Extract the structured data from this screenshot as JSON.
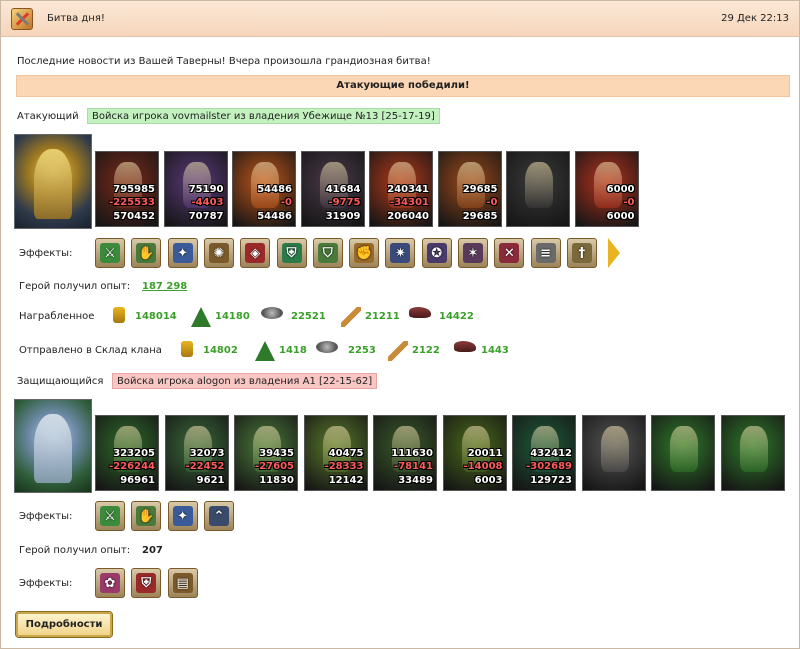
{
  "window": {
    "title": "Битва дня!",
    "date": "29 Дек 22:13"
  },
  "news": "Последние новости из Вашей Таверны! Вчера произошла грандиозная битва!",
  "banner": "Атакующие победили!",
  "attacker": {
    "label": "Атакующий",
    "tag": "Войска игрока vovmailster из владения Убежище №13 [25-17-19]",
    "units": [
      {
        "a": "795985",
        "b": "-225533",
        "c": "570452",
        "color": "#7a2a1a"
      },
      {
        "a": "75190",
        "b": "-4403",
        "c": "70787",
        "color": "#5a3a7a"
      },
      {
        "a": "54486",
        "b": "-0",
        "c": "54486",
        "color": "#c0561a"
      },
      {
        "a": "41684",
        "b": "-9775",
        "c": "31909",
        "color": "#4a3a4a"
      },
      {
        "a": "240341",
        "b": "-34301",
        "c": "206040",
        "color": "#b33a1a"
      },
      {
        "a": "29685",
        "b": "-0",
        "c": "29685",
        "color": "#9c4a1a"
      },
      {
        "a": "",
        "b": "",
        "c": "",
        "color": "#3a3a3a"
      },
      {
        "a": "6000",
        "b": "-0",
        "c": "6000",
        "color": "#b3321e"
      }
    ],
    "effects_label": "Эффекты:",
    "effects": [
      {
        "icon": "sword-icon",
        "glyph": "⚔",
        "color": "#3c8a3c"
      },
      {
        "icon": "handshake-icon",
        "glyph": "✋",
        "color": "#4a7a3a"
      },
      {
        "icon": "magic-hand-icon",
        "glyph": "✦",
        "color": "#3a5a9a"
      },
      {
        "icon": "wolf-icon",
        "glyph": "✺",
        "color": "#7a5a2a"
      },
      {
        "icon": "dice-icon",
        "glyph": "◈",
        "color": "#9a2a2a"
      },
      {
        "icon": "shield-icon",
        "glyph": "⛨",
        "color": "#2a7a4a"
      },
      {
        "icon": "shield-hand-icon",
        "glyph": "⛉",
        "color": "#4a7a3a"
      },
      {
        "icon": "fist-icon",
        "glyph": "✊",
        "color": "#9a6a2a"
      },
      {
        "icon": "dragon-icon",
        "glyph": "✷",
        "color": "#3a4a7a"
      },
      {
        "icon": "pentagram-icon",
        "glyph": "✪",
        "color": "#4a3a6a"
      },
      {
        "icon": "spikes-icon",
        "glyph": "✶",
        "color": "#5a3a5a"
      },
      {
        "icon": "crossed-blades-icon",
        "glyph": "✕",
        "color": "#8a2a3a"
      },
      {
        "icon": "scroll-icon",
        "glyph": "≡",
        "color": "#6a6a6a"
      },
      {
        "icon": "dagger-icon",
        "glyph": "†",
        "color": "#7a6a3a"
      }
    ],
    "exp_label": "Герой получил опыт:",
    "exp_value": "187 298",
    "loot_label": "Награбленное",
    "loot": [
      {
        "icon": "gold-icon",
        "value": "148014",
        "color": "#e8b420"
      },
      {
        "icon": "wood-icon",
        "value": "14180",
        "color": "#2f7a2a"
      },
      {
        "icon": "ore-icon",
        "value": "22521",
        "color": "#555555"
      },
      {
        "icon": "wheat-icon",
        "value": "21211",
        "color": "#c98a3a"
      },
      {
        "icon": "meat-icon",
        "value": "14422",
        "color": "#8a3a3a"
      }
    ],
    "clan_label": "Отправлено в Склад клана",
    "clan": [
      {
        "icon": "gold-icon",
        "value": "14802",
        "color": "#e8b420"
      },
      {
        "icon": "wood-icon",
        "value": "1418",
        "color": "#2f7a2a"
      },
      {
        "icon": "ore-icon",
        "value": "2253",
        "color": "#555555"
      },
      {
        "icon": "wheat-icon",
        "value": "2122",
        "color": "#c98a3a"
      },
      {
        "icon": "meat-icon",
        "value": "1443",
        "color": "#8a3a3a"
      }
    ]
  },
  "defender": {
    "label": "Защищающийся",
    "tag": "Войска игрока alogon из владения A1 [22-15-62]",
    "units": [
      {
        "a": "323205",
        "b": "-226244",
        "c": "96961",
        "color": "#2f6a2a"
      },
      {
        "a": "32073",
        "b": "-22452",
        "c": "9621",
        "color": "#3a6a3a"
      },
      {
        "a": "39435",
        "b": "-27605",
        "c": "11830",
        "color": "#4a7a3a"
      },
      {
        "a": "40475",
        "b": "-28333",
        "c": "12142",
        "color": "#5a7a2a"
      },
      {
        "a": "111630",
        "b": "-78141",
        "c": "33489",
        "color": "#3a5a2a"
      },
      {
        "a": "20011",
        "b": "-14008",
        "c": "6003",
        "color": "#4a6a1a"
      },
      {
        "a": "432412",
        "b": "-302689",
        "c": "129723",
        "color": "#1f5a3a"
      },
      {
        "a": "",
        "b": "",
        "c": "",
        "color": "#555555"
      },
      {
        "a": "",
        "b": "",
        "c": "",
        "color": "#2f7a2a"
      },
      {
        "a": "",
        "b": "",
        "c": "",
        "color": "#2f7a2a"
      }
    ],
    "effects_label": "Эффекты:",
    "effects": [
      {
        "icon": "sword-icon",
        "glyph": "⚔",
        "color": "#3c8a3c"
      },
      {
        "icon": "handshake-icon",
        "glyph": "✋",
        "color": "#4a7a3a"
      },
      {
        "icon": "magic-hand-icon",
        "glyph": "✦",
        "color": "#3a5a9a"
      },
      {
        "icon": "chevron-up-icon",
        "glyph": "⌃",
        "color": "#3a4a6a"
      }
    ],
    "exp_label": "Герой получил опыт:",
    "exp_value": "207",
    "effects2_label": "Эффекты:",
    "effects2": [
      {
        "icon": "potion-icon",
        "glyph": "✿",
        "color": "#9a3a6a"
      },
      {
        "icon": "shield-icon",
        "glyph": "⛨",
        "color": "#9a2a2a"
      },
      {
        "icon": "book-icon",
        "glyph": "▤",
        "color": "#7a5a2a"
      }
    ]
  },
  "details_button": "Подробности"
}
